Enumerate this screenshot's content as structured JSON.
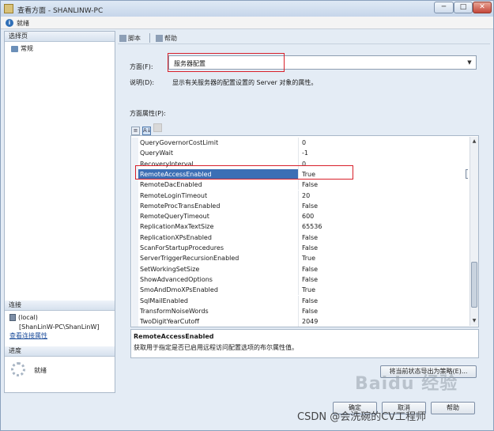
{
  "window": {
    "title": "查看方面 - SHANLINW-PC",
    "controls": {
      "minimize": "─",
      "maximize": "□",
      "close": "✕"
    }
  },
  "status": {
    "icon": "info-icon",
    "text": "就绪"
  },
  "left_pane": {
    "select_page_header": "选择页",
    "pages": [
      {
        "label": "常规",
        "icon": "page-icon"
      }
    ],
    "connection_header": "连接",
    "connection": {
      "server": "(local)",
      "user": "[ShanLinW-PC\\ShanLinW]",
      "link": "查看连接属性"
    },
    "progress_header": "进度",
    "progress_text": "就绪"
  },
  "toolbar": {
    "script_label": "脚本",
    "help_label": "帮助"
  },
  "facet": {
    "label": "方面(F):",
    "selected": "服务器配置",
    "description_label": "说明(D):",
    "description": "显示有关服务器的配置设置的 Server 对象的属性。"
  },
  "properties": {
    "label": "方面属性(P):",
    "tool_icons": [
      "categorized-icon",
      "alphabetical-icon",
      "property-pages-icon"
    ],
    "rows": [
      {
        "name": "QueryGovernorCostLimit",
        "value": "0"
      },
      {
        "name": "QueryWait",
        "value": "-1"
      },
      {
        "name": "RecoveryInterval",
        "value": "0"
      },
      {
        "name": "RemoteAccessEnabled",
        "value": "True",
        "selected": true
      },
      {
        "name": "RemoteDacEnabled",
        "value": "False"
      },
      {
        "name": "RemoteLoginTimeout",
        "value": "20"
      },
      {
        "name": "RemoteProcTransEnabled",
        "value": "False"
      },
      {
        "name": "RemoteQueryTimeout",
        "value": "600"
      },
      {
        "name": "ReplicationMaxTextSize",
        "value": "65536"
      },
      {
        "name": "ReplicationXPsEnabled",
        "value": "False"
      },
      {
        "name": "ScanForStartupProcedures",
        "value": "False"
      },
      {
        "name": "ServerTriggerRecursionEnabled",
        "value": "True"
      },
      {
        "name": "SetWorkingSetSize",
        "value": "False"
      },
      {
        "name": "ShowAdvancedOptions",
        "value": "False"
      },
      {
        "name": "SmoAndDmoXPsEnabled",
        "value": "True"
      },
      {
        "name": "SqlMailEnabled",
        "value": "False"
      },
      {
        "name": "TransformNoiseWords",
        "value": "False"
      },
      {
        "name": "TwoDigitYearCutoff",
        "value": "2049"
      }
    ],
    "selected_description_title": "RemoteAccessEnabled",
    "selected_description": "获取用于指定是否已启用远程访问配置选项的布尔属性值。"
  },
  "buttons": {
    "export_label": "将当前状态导出为策略(E)...",
    "ok_label": "确定",
    "cancel_label": "取消",
    "help_label": "帮助"
  },
  "watermarks": {
    "baidu": "Baidu 经验",
    "csdn": "CSDN @会洗碗的CV工程师"
  },
  "colors": {
    "highlight": "#d8202a",
    "selection": "#3c6fb5"
  }
}
